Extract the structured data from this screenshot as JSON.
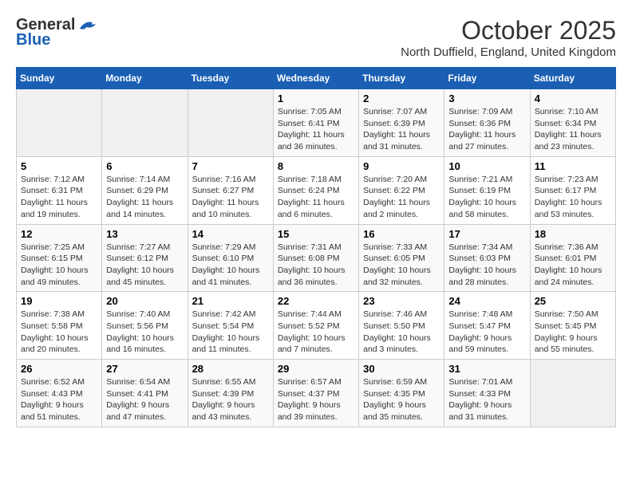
{
  "header": {
    "logo_general": "General",
    "logo_blue": "Blue",
    "month_title": "October 2025",
    "location": "North Duffield, England, United Kingdom"
  },
  "days_of_week": [
    "Sunday",
    "Monday",
    "Tuesday",
    "Wednesday",
    "Thursday",
    "Friday",
    "Saturday"
  ],
  "weeks": [
    [
      {
        "day": "",
        "info": ""
      },
      {
        "day": "",
        "info": ""
      },
      {
        "day": "",
        "info": ""
      },
      {
        "day": "1",
        "info": "Sunrise: 7:05 AM\nSunset: 6:41 PM\nDaylight: 11 hours and 36 minutes."
      },
      {
        "day": "2",
        "info": "Sunrise: 7:07 AM\nSunset: 6:39 PM\nDaylight: 11 hours and 31 minutes."
      },
      {
        "day": "3",
        "info": "Sunrise: 7:09 AM\nSunset: 6:36 PM\nDaylight: 11 hours and 27 minutes."
      },
      {
        "day": "4",
        "info": "Sunrise: 7:10 AM\nSunset: 6:34 PM\nDaylight: 11 hours and 23 minutes."
      }
    ],
    [
      {
        "day": "5",
        "info": "Sunrise: 7:12 AM\nSunset: 6:31 PM\nDaylight: 11 hours and 19 minutes."
      },
      {
        "day": "6",
        "info": "Sunrise: 7:14 AM\nSunset: 6:29 PM\nDaylight: 11 hours and 14 minutes."
      },
      {
        "day": "7",
        "info": "Sunrise: 7:16 AM\nSunset: 6:27 PM\nDaylight: 11 hours and 10 minutes."
      },
      {
        "day": "8",
        "info": "Sunrise: 7:18 AM\nSunset: 6:24 PM\nDaylight: 11 hours and 6 minutes."
      },
      {
        "day": "9",
        "info": "Sunrise: 7:20 AM\nSunset: 6:22 PM\nDaylight: 11 hours and 2 minutes."
      },
      {
        "day": "10",
        "info": "Sunrise: 7:21 AM\nSunset: 6:19 PM\nDaylight: 10 hours and 58 minutes."
      },
      {
        "day": "11",
        "info": "Sunrise: 7:23 AM\nSunset: 6:17 PM\nDaylight: 10 hours and 53 minutes."
      }
    ],
    [
      {
        "day": "12",
        "info": "Sunrise: 7:25 AM\nSunset: 6:15 PM\nDaylight: 10 hours and 49 minutes."
      },
      {
        "day": "13",
        "info": "Sunrise: 7:27 AM\nSunset: 6:12 PM\nDaylight: 10 hours and 45 minutes."
      },
      {
        "day": "14",
        "info": "Sunrise: 7:29 AM\nSunset: 6:10 PM\nDaylight: 10 hours and 41 minutes."
      },
      {
        "day": "15",
        "info": "Sunrise: 7:31 AM\nSunset: 6:08 PM\nDaylight: 10 hours and 36 minutes."
      },
      {
        "day": "16",
        "info": "Sunrise: 7:33 AM\nSunset: 6:05 PM\nDaylight: 10 hours and 32 minutes."
      },
      {
        "day": "17",
        "info": "Sunrise: 7:34 AM\nSunset: 6:03 PM\nDaylight: 10 hours and 28 minutes."
      },
      {
        "day": "18",
        "info": "Sunrise: 7:36 AM\nSunset: 6:01 PM\nDaylight: 10 hours and 24 minutes."
      }
    ],
    [
      {
        "day": "19",
        "info": "Sunrise: 7:38 AM\nSunset: 5:58 PM\nDaylight: 10 hours and 20 minutes."
      },
      {
        "day": "20",
        "info": "Sunrise: 7:40 AM\nSunset: 5:56 PM\nDaylight: 10 hours and 16 minutes."
      },
      {
        "day": "21",
        "info": "Sunrise: 7:42 AM\nSunset: 5:54 PM\nDaylight: 10 hours and 11 minutes."
      },
      {
        "day": "22",
        "info": "Sunrise: 7:44 AM\nSunset: 5:52 PM\nDaylight: 10 hours and 7 minutes."
      },
      {
        "day": "23",
        "info": "Sunrise: 7:46 AM\nSunset: 5:50 PM\nDaylight: 10 hours and 3 minutes."
      },
      {
        "day": "24",
        "info": "Sunrise: 7:48 AM\nSunset: 5:47 PM\nDaylight: 9 hours and 59 minutes."
      },
      {
        "day": "25",
        "info": "Sunrise: 7:50 AM\nSunset: 5:45 PM\nDaylight: 9 hours and 55 minutes."
      }
    ],
    [
      {
        "day": "26",
        "info": "Sunrise: 6:52 AM\nSunset: 4:43 PM\nDaylight: 9 hours and 51 minutes."
      },
      {
        "day": "27",
        "info": "Sunrise: 6:54 AM\nSunset: 4:41 PM\nDaylight: 9 hours and 47 minutes."
      },
      {
        "day": "28",
        "info": "Sunrise: 6:55 AM\nSunset: 4:39 PM\nDaylight: 9 hours and 43 minutes."
      },
      {
        "day": "29",
        "info": "Sunrise: 6:57 AM\nSunset: 4:37 PM\nDaylight: 9 hours and 39 minutes."
      },
      {
        "day": "30",
        "info": "Sunrise: 6:59 AM\nSunset: 4:35 PM\nDaylight: 9 hours and 35 minutes."
      },
      {
        "day": "31",
        "info": "Sunrise: 7:01 AM\nSunset: 4:33 PM\nDaylight: 9 hours and 31 minutes."
      },
      {
        "day": "",
        "info": ""
      }
    ]
  ]
}
